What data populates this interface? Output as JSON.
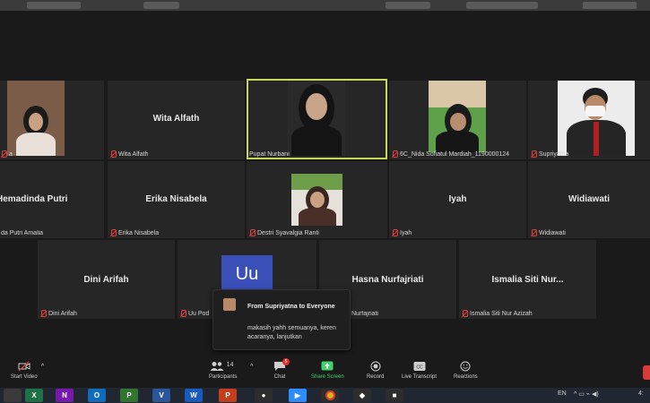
{
  "participants": [
    {
      "id": "t1",
      "name": "",
      "label": "a",
      "has_video": true
    },
    {
      "id": "t2",
      "name": "Wita Alfath",
      "label": "Wita Alfath",
      "has_video": false
    },
    {
      "id": "t3",
      "name": "",
      "label": "Pupat Nurbani",
      "has_video": true,
      "active_speaker": true
    },
    {
      "id": "t4",
      "name": "",
      "label": "6C_Nida Sofiatul Mardiah_1190000124",
      "has_video": true
    },
    {
      "id": "t5",
      "name": "",
      "label": "Supriyatna",
      "has_video": true
    },
    {
      "id": "t6",
      "name": "Hemadinda Putri",
      "label": "da Putri Amalia",
      "has_video": false
    },
    {
      "id": "t7",
      "name": "Erika Nisabela",
      "label": "Erika Nisabela",
      "has_video": false
    },
    {
      "id": "t8",
      "name": "",
      "label": "Destri Syavalgia Ranti",
      "has_video": true
    },
    {
      "id": "t9",
      "name": "Iyah",
      "label": "Iyah",
      "has_video": false
    },
    {
      "id": "t10",
      "name": "Widiawati",
      "label": "Widiawati",
      "has_video": false
    },
    {
      "id": "t11",
      "name": "Dini Arifah",
      "label": "Dini Arifah",
      "has_video": false
    },
    {
      "id": "t12",
      "name": "",
      "label": "Uu Pod",
      "avatar_text": "Uu",
      "has_video": false
    },
    {
      "id": "t13",
      "name": "Hasna Nurfajriati",
      "label": "Nurfajriati",
      "has_video": false
    },
    {
      "id": "t14",
      "name": "Ismalia Siti Nur...",
      "label": "Ismalia Siti Nur Azizah",
      "has_video": false
    }
  ],
  "chat_popup": {
    "from": "From Supriyatna to Everyone",
    "message": "makasih yahh semuanya, keren acaranya, lanjutkan"
  },
  "toolbar": {
    "start_video": "Start Video",
    "participants": "Participants",
    "participants_count": "14",
    "chat": "Chat",
    "chat_badge": "5",
    "share_screen": "Share Screen",
    "record": "Record",
    "live_transcript": "Live Transcript",
    "reactions": "Reactions"
  },
  "taskbar": {
    "lang": "EN",
    "time": "4:"
  },
  "colors": {
    "active_speaker_border": "#c8d85a",
    "share_screen_green": "#3fd46a",
    "muted_red": "#e04040",
    "avatar_blue": "#3a4fb8"
  }
}
